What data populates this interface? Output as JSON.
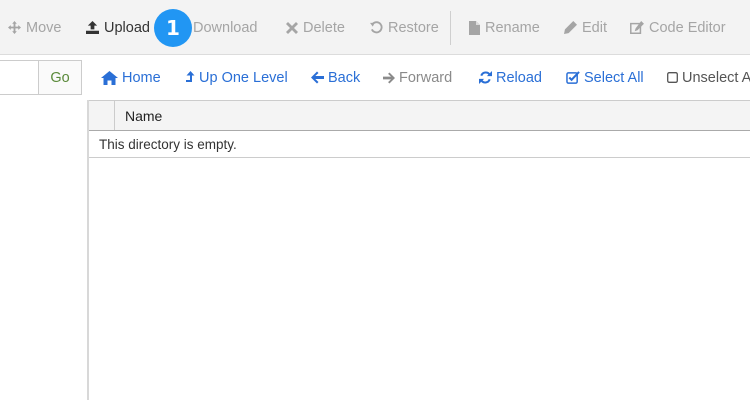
{
  "toolbar": {
    "move": "Move",
    "upload": "Upload",
    "download": "Download",
    "delete": "Delete",
    "restore": "Restore",
    "rename": "Rename",
    "edit": "Edit",
    "code_editor": "Code Editor"
  },
  "step_badge": "1",
  "path_bar": {
    "input_value": "",
    "go_label": "Go"
  },
  "nav": {
    "home": "Home",
    "up_one_level": "Up One Level",
    "back": "Back",
    "forward": "Forward",
    "reload": "Reload",
    "select_all": "Select All",
    "unselect_all": "Unselect All"
  },
  "table": {
    "columns": [
      "",
      "Name"
    ],
    "empty_message": "This directory is empty."
  },
  "colors": {
    "link_blue": "#2a6fd6",
    "badge_blue": "#2196f3",
    "disabled_gray": "#a5a5a5",
    "go_green": "#5a8a3a"
  },
  "icons": [
    "move-icon",
    "upload-icon",
    "delete-icon",
    "restore-icon",
    "rename-icon",
    "edit-icon",
    "code-editor-icon",
    "home-icon",
    "up-level-icon",
    "back-arrow-icon",
    "forward-arrow-icon",
    "reload-icon",
    "select-all-icon",
    "unselect-all-icon"
  ]
}
